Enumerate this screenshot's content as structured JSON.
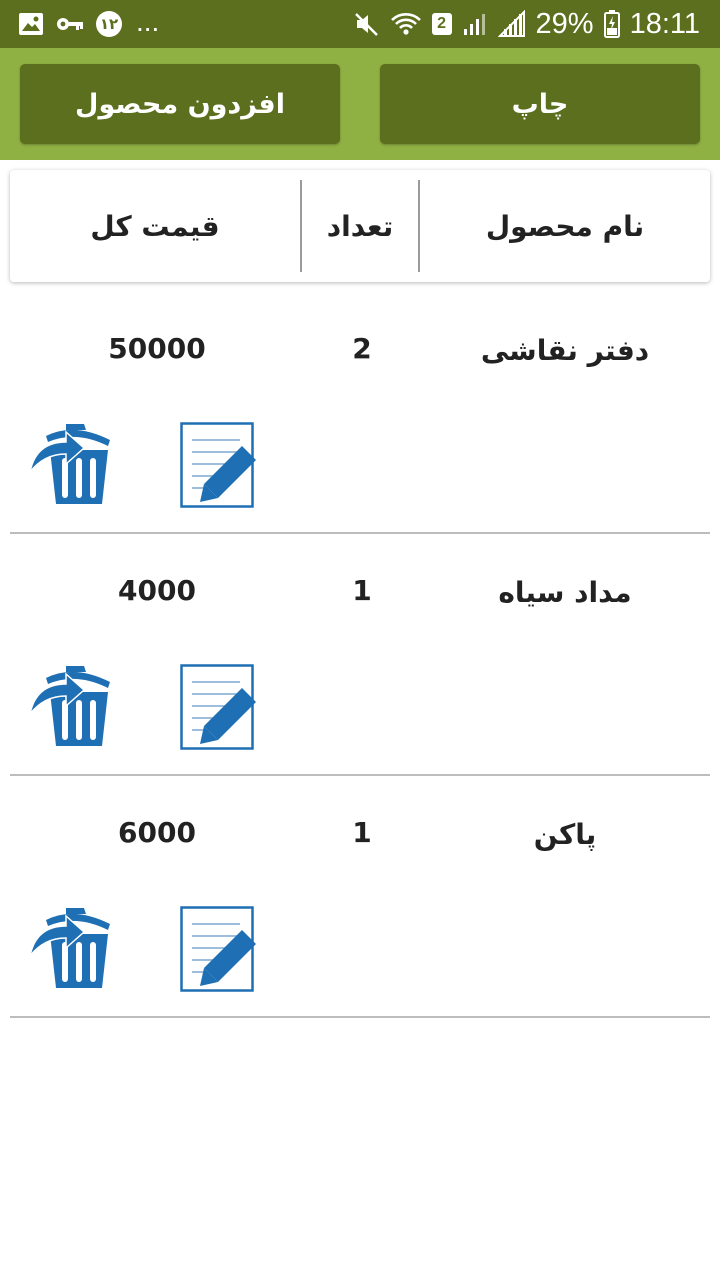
{
  "status_bar": {
    "notif_badge": "۱۲",
    "more": "...",
    "sim_badge": "2",
    "battery": "29%",
    "time": "18:11"
  },
  "toolbar": {
    "print_label": "چاپ",
    "add_product_label": "افزدون محصول"
  },
  "table_header": {
    "product_name": "نام محصول",
    "quantity": "تعداد",
    "total_price": "قيمت كل"
  },
  "rows": [
    {
      "name": "دفتر نقاشی",
      "qty": "2",
      "total": "50000"
    },
    {
      "name": "مداد سیاه",
      "qty": "1",
      "total": "4000"
    },
    {
      "name": "پاکن",
      "qty": "1",
      "total": "6000"
    }
  ],
  "colors": {
    "status_bar": "#5c6f1e",
    "toolbar_bg": "#8fb043",
    "button_bg": "#5c6f1e",
    "icon_blue": "#1e6fb4"
  },
  "icons": {
    "edit": "edit-document-icon",
    "delete": "trash-icon"
  }
}
